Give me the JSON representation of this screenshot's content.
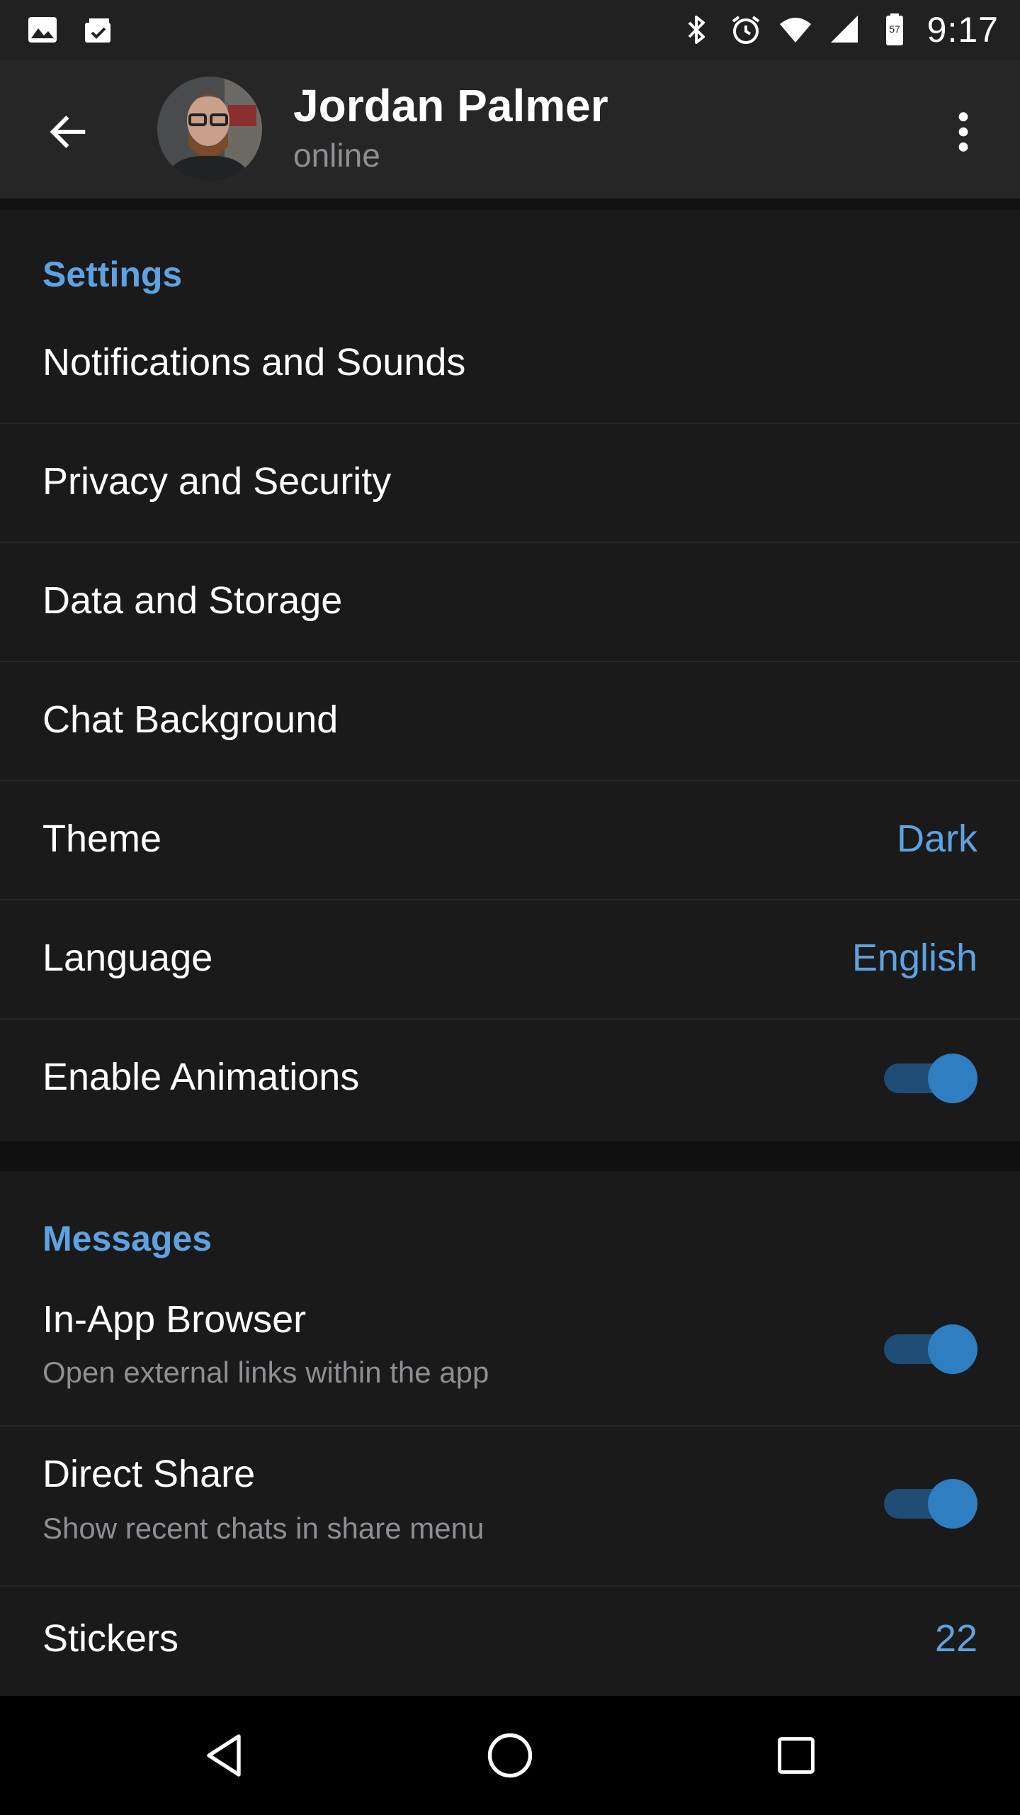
{
  "status_bar": {
    "time": "9:17",
    "battery_level": "57",
    "left_icons": [
      "image-icon",
      "clipboard-check-icon"
    ],
    "right_icons": [
      "bluetooth-icon",
      "alarm-icon",
      "wifi-icon",
      "cell-signal-icon",
      "battery-icon"
    ]
  },
  "header": {
    "title": "Jordan Palmer",
    "subtitle": "online",
    "back_icon": "arrow-back-icon",
    "menu_icon": "more-vert-icon"
  },
  "settings_section": {
    "title": "Settings",
    "items": [
      {
        "label": "Notifications and Sounds"
      },
      {
        "label": "Privacy and Security"
      },
      {
        "label": "Data and Storage"
      },
      {
        "label": "Chat Background"
      },
      {
        "label": "Theme",
        "value": "Dark"
      },
      {
        "label": "Language",
        "value": "English"
      },
      {
        "label": "Enable Animations",
        "toggle": true
      }
    ]
  },
  "messages_section": {
    "title": "Messages",
    "items": [
      {
        "label": "In-App Browser",
        "sublabel": "Open external links within the app",
        "toggle": true
      },
      {
        "label": "Direct Share",
        "sublabel": "Show recent chats in share menu",
        "toggle": true
      },
      {
        "label": "Stickers",
        "value": "22"
      }
    ]
  },
  "nav_bar": {
    "icons": [
      "nav-back-icon",
      "nav-home-icon",
      "nav-recents-icon"
    ]
  },
  "colors": {
    "accent": "#5ea2e0",
    "background": "#1a1a1b",
    "header": "#262627",
    "toggle_track": "#1f4d75",
    "toggle_thumb": "#2f7ec1",
    "secondary_text": "#8e8e93"
  }
}
